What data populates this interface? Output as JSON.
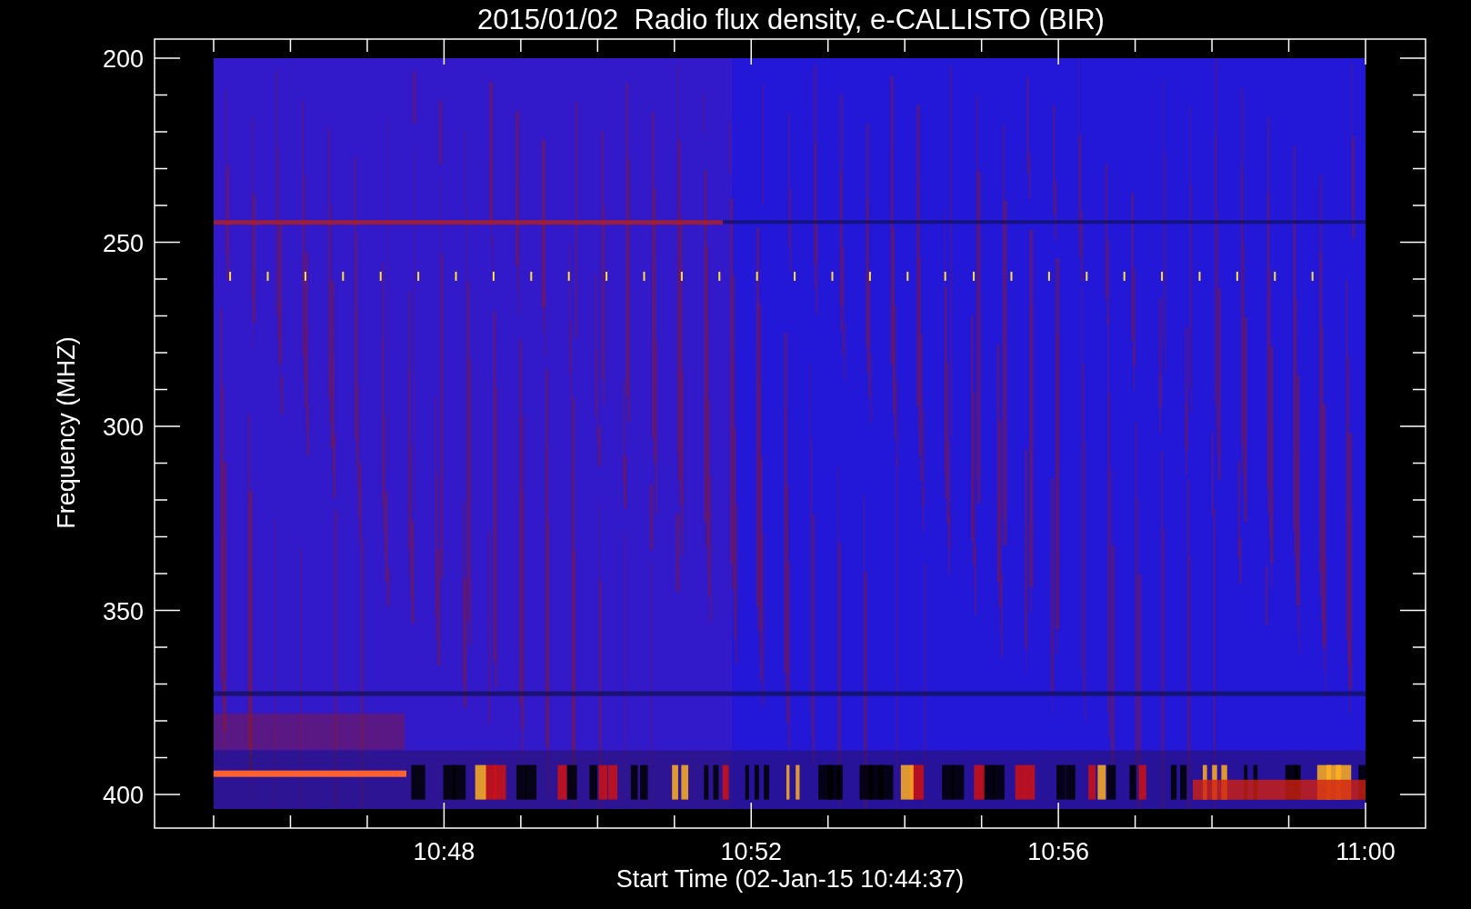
{
  "title": "2015/01/02  Radio flux density, e-CALLISTO (BIR)",
  "y_axis": {
    "label": "Frequency (MHZ)",
    "ticks": [
      "200",
      "250",
      "300",
      "350",
      "400"
    ]
  },
  "x_axis": {
    "label": "Start Time (02-Jan-15 10:44:37)",
    "ticks": [
      "10:48",
      "10:52",
      "10:56",
      "11:00"
    ]
  }
}
